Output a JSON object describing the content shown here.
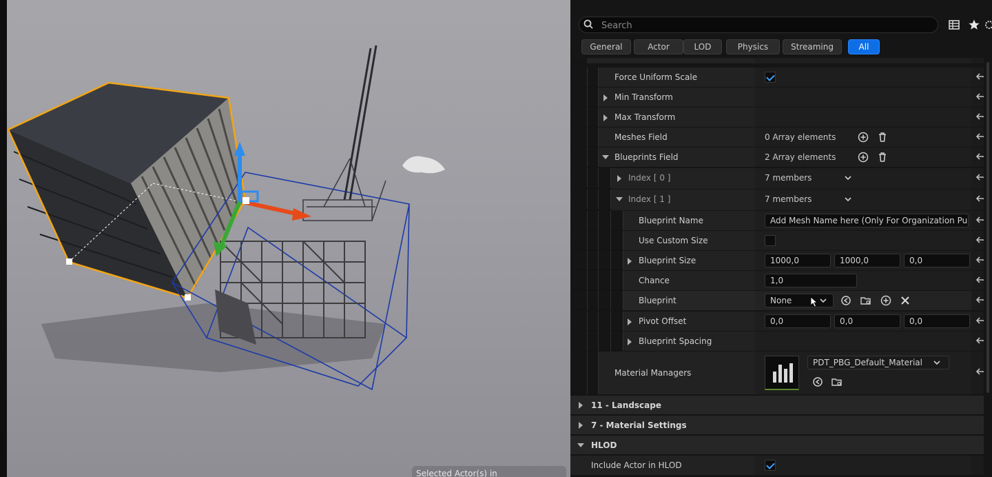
{
  "search": {
    "placeholder": "Search"
  },
  "top_icons": [
    "table-icon",
    "star-icon",
    "settings-icon"
  ],
  "tabs": [
    "General",
    "Actor",
    "LOD",
    "Physics",
    "Streaming",
    "All"
  ],
  "active_tab": "All",
  "accent_color": "#0e6ee6",
  "properties": {
    "force_uniform_scale": {
      "label": "Force Uniform Scale",
      "checked": true
    },
    "min_transform": {
      "label": "Min Transform"
    },
    "max_transform": {
      "label": "Max Transform"
    },
    "meshes_field": {
      "label": "Meshes Field",
      "value": "0 Array elements"
    },
    "blueprints_field": {
      "label": "Blueprints Field",
      "value": "2 Array elements"
    },
    "index0": {
      "label": "Index [ 0 ]",
      "value": "7 members"
    },
    "index1": {
      "label": "Index [ 1 ]",
      "value": "7 members"
    },
    "blueprint_name": {
      "label": "Blueprint Name",
      "value": "Add Mesh Name here (Only For Organization Purpo"
    },
    "use_custom_size": {
      "label": "Use Custom Size",
      "checked": false
    },
    "blueprint_size": {
      "label": "Blueprint Size",
      "x": "1000,0",
      "y": "1000,0",
      "z": "0,0"
    },
    "chance": {
      "label": "Chance",
      "value": "1,0"
    },
    "blueprint": {
      "label": "Blueprint",
      "value": "None"
    },
    "pivot_offset": {
      "label": "Pivot Offset",
      "x": "0,0",
      "y": "0,0",
      "z": "0,0"
    },
    "blueprint_spacing": {
      "label": "Blueprint Spacing"
    },
    "material_managers": {
      "label": "Material Managers",
      "value": "PDT_PBG_Default_Material"
    }
  },
  "sections": {
    "landscape": "11 - Landscape",
    "material_settings": "7 - Material Settings",
    "hlod": "HLOD"
  },
  "include_actor_in_hlod": {
    "label": "Include Actor in HLOD",
    "checked": true
  },
  "viewport": {
    "status": "Selected Actor(s) in"
  }
}
